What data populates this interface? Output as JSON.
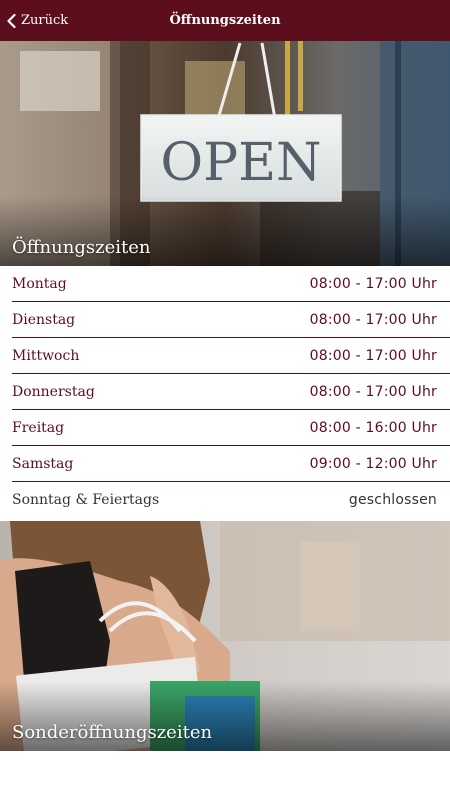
{
  "header": {
    "back_label": "Zurück",
    "title": "Öffnungszeiten"
  },
  "hero_top": {
    "caption": "Öffnungszeiten",
    "sign_text": "OPEN"
  },
  "hours": [
    {
      "day": "Montag",
      "time": "08:00 - 17:00 Uhr"
    },
    {
      "day": "Dienstag",
      "time": "08:00 - 17:00 Uhr"
    },
    {
      "day": "Mittwoch",
      "time": "08:00 - 17:00 Uhr"
    },
    {
      "day": "Donnerstag",
      "time": "08:00 - 17:00 Uhr"
    },
    {
      "day": "Freitag",
      "time": "08:00 - 16:00 Uhr"
    },
    {
      "day": "Samstag",
      "time": "09:00 - 12:00 Uhr"
    },
    {
      "day": "Sonntag & Feiertags",
      "time": "geschlossen"
    }
  ],
  "hero_bottom": {
    "caption": "Sonderöffnungszeiten"
  },
  "colors": {
    "brand": "#5c0e1c",
    "text_dark": "#333333",
    "background": "#ffffff"
  },
  "icons": {
    "back": "chevron-left-icon"
  }
}
